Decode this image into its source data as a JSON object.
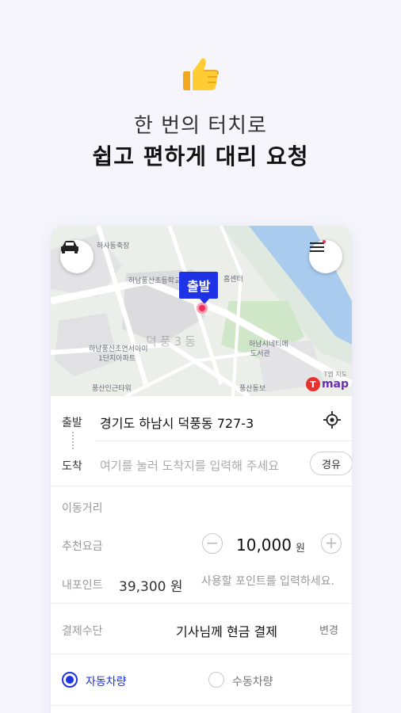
{
  "hero": {
    "line1": "한 번의 터치로",
    "line2": "쉽고 편하게 대리 요청",
    "emoji": "👍"
  },
  "map": {
    "pin_label": "출발",
    "watermark": "덕풍3동",
    "provider_logo": "T",
    "provider_name": "map",
    "provider_sub": "T맵 지도",
    "labels": [
      "하사동축장",
      "하남풍산초등학교",
      "하남풍산초연서아이",
      "1단지아파트",
      "풍산인근타워",
      "하남시네티에",
      "도서관",
      "풍산동보",
      "홈센터"
    ],
    "icons": {
      "left": "car-icon",
      "right": "menu-icon"
    }
  },
  "route": {
    "depart_label": "출발",
    "depart_address": "경기도 하남시 덕풍동 727-3",
    "arrive_label": "도착",
    "arrive_placeholder": "여기를 눌러 도착지를 입력해 주세요",
    "via_button": "경유"
  },
  "fare": {
    "distance_label": "이동거리",
    "recommend_label": "추천요금",
    "recommend_value": "10,000",
    "recommend_unit": "원",
    "minus": "−",
    "plus": "+",
    "points_label": "내포인트",
    "points_value": "39,300 원",
    "points_placeholder": "사용할 포인트를 입력하세요."
  },
  "payment": {
    "label": "결제수단",
    "method": "기사님께 현금 결제",
    "change": "변경"
  },
  "vehicle": {
    "options": [
      {
        "label": "자동차량",
        "selected": true
      },
      {
        "label": "수동차량",
        "selected": false
      }
    ]
  },
  "colors": {
    "accent": "#1f33e6",
    "pin": "#ea2f58",
    "background": "#f6f5fc"
  }
}
